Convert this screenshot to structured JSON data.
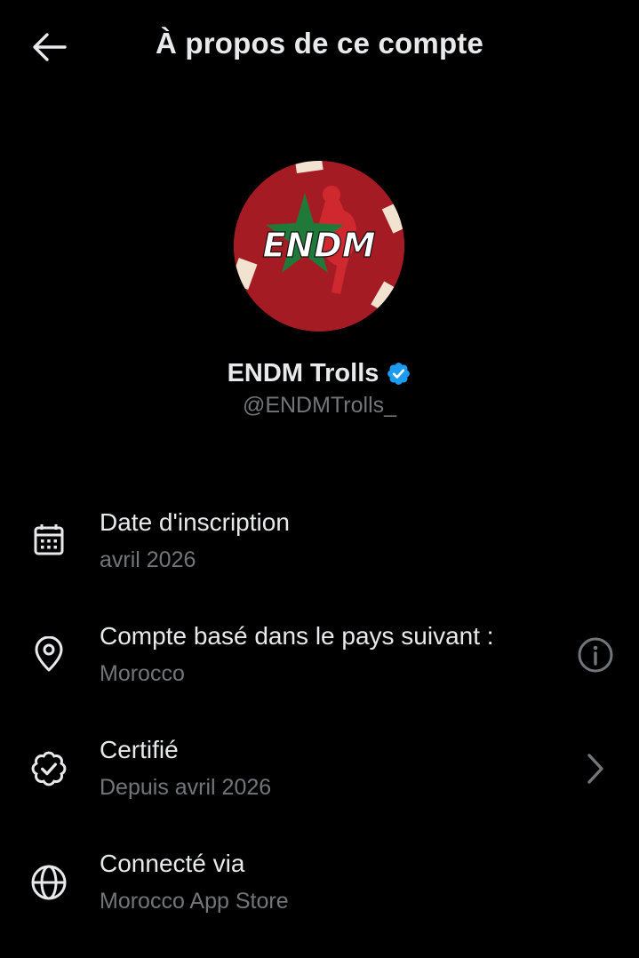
{
  "header": {
    "title": "À propos de ce compte",
    "back_icon": "arrow-left-icon"
  },
  "profile": {
    "display_name": "ENDM Trolls",
    "handle": "@ENDMTrolls_",
    "verified": true,
    "verified_color": "#1d9bf0",
    "avatar_bg": "#a51b24",
    "avatar_logo_text": "ENDM"
  },
  "details": [
    {
      "icon": "calendar-icon",
      "label": "Date d'inscription",
      "value": "avril 2026"
    },
    {
      "icon": "location-pin-icon",
      "label": "Compte basé dans le pays suivant :",
      "value": "Morocco",
      "trailing_icon": "info-icon"
    },
    {
      "icon": "verified-badge-outline-icon",
      "label": "Certifié",
      "value": "Depuis avril 2026",
      "trailing_icon": "chevron-right-icon"
    },
    {
      "icon": "globe-icon",
      "label": "Connecté via",
      "value": "Morocco App Store"
    }
  ],
  "colors": {
    "background": "#000000",
    "primary_text": "#e7e9ea",
    "secondary_text": "#71767b"
  }
}
